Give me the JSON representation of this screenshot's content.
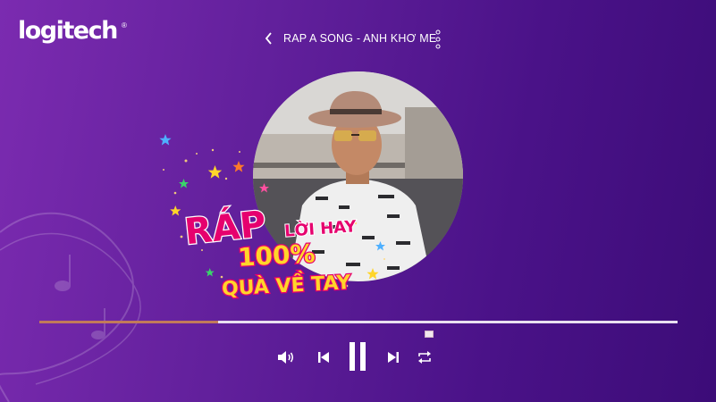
{
  "brand": {
    "logo_text": "logitech",
    "registered_mark": "®"
  },
  "header": {
    "song_title": "RAP A SONG - ANH KHƠ ME"
  },
  "promo": {
    "line1": "RÁP",
    "line2": "LỜI HAY",
    "line3": "100%",
    "line4": "QUÀ VỀ TAY"
  },
  "player": {
    "progress_fraction": 0.28,
    "progress_color": "#c27a5a",
    "controls": [
      "volume-icon",
      "previous-icon",
      "pause-icon",
      "next-icon",
      "repeat-icon"
    ]
  },
  "colors": {
    "background_left": "#7b2bb0",
    "background_right": "#3c0c78",
    "promo_pink": "#e6006e",
    "promo_yellow": "#ffd52a"
  }
}
